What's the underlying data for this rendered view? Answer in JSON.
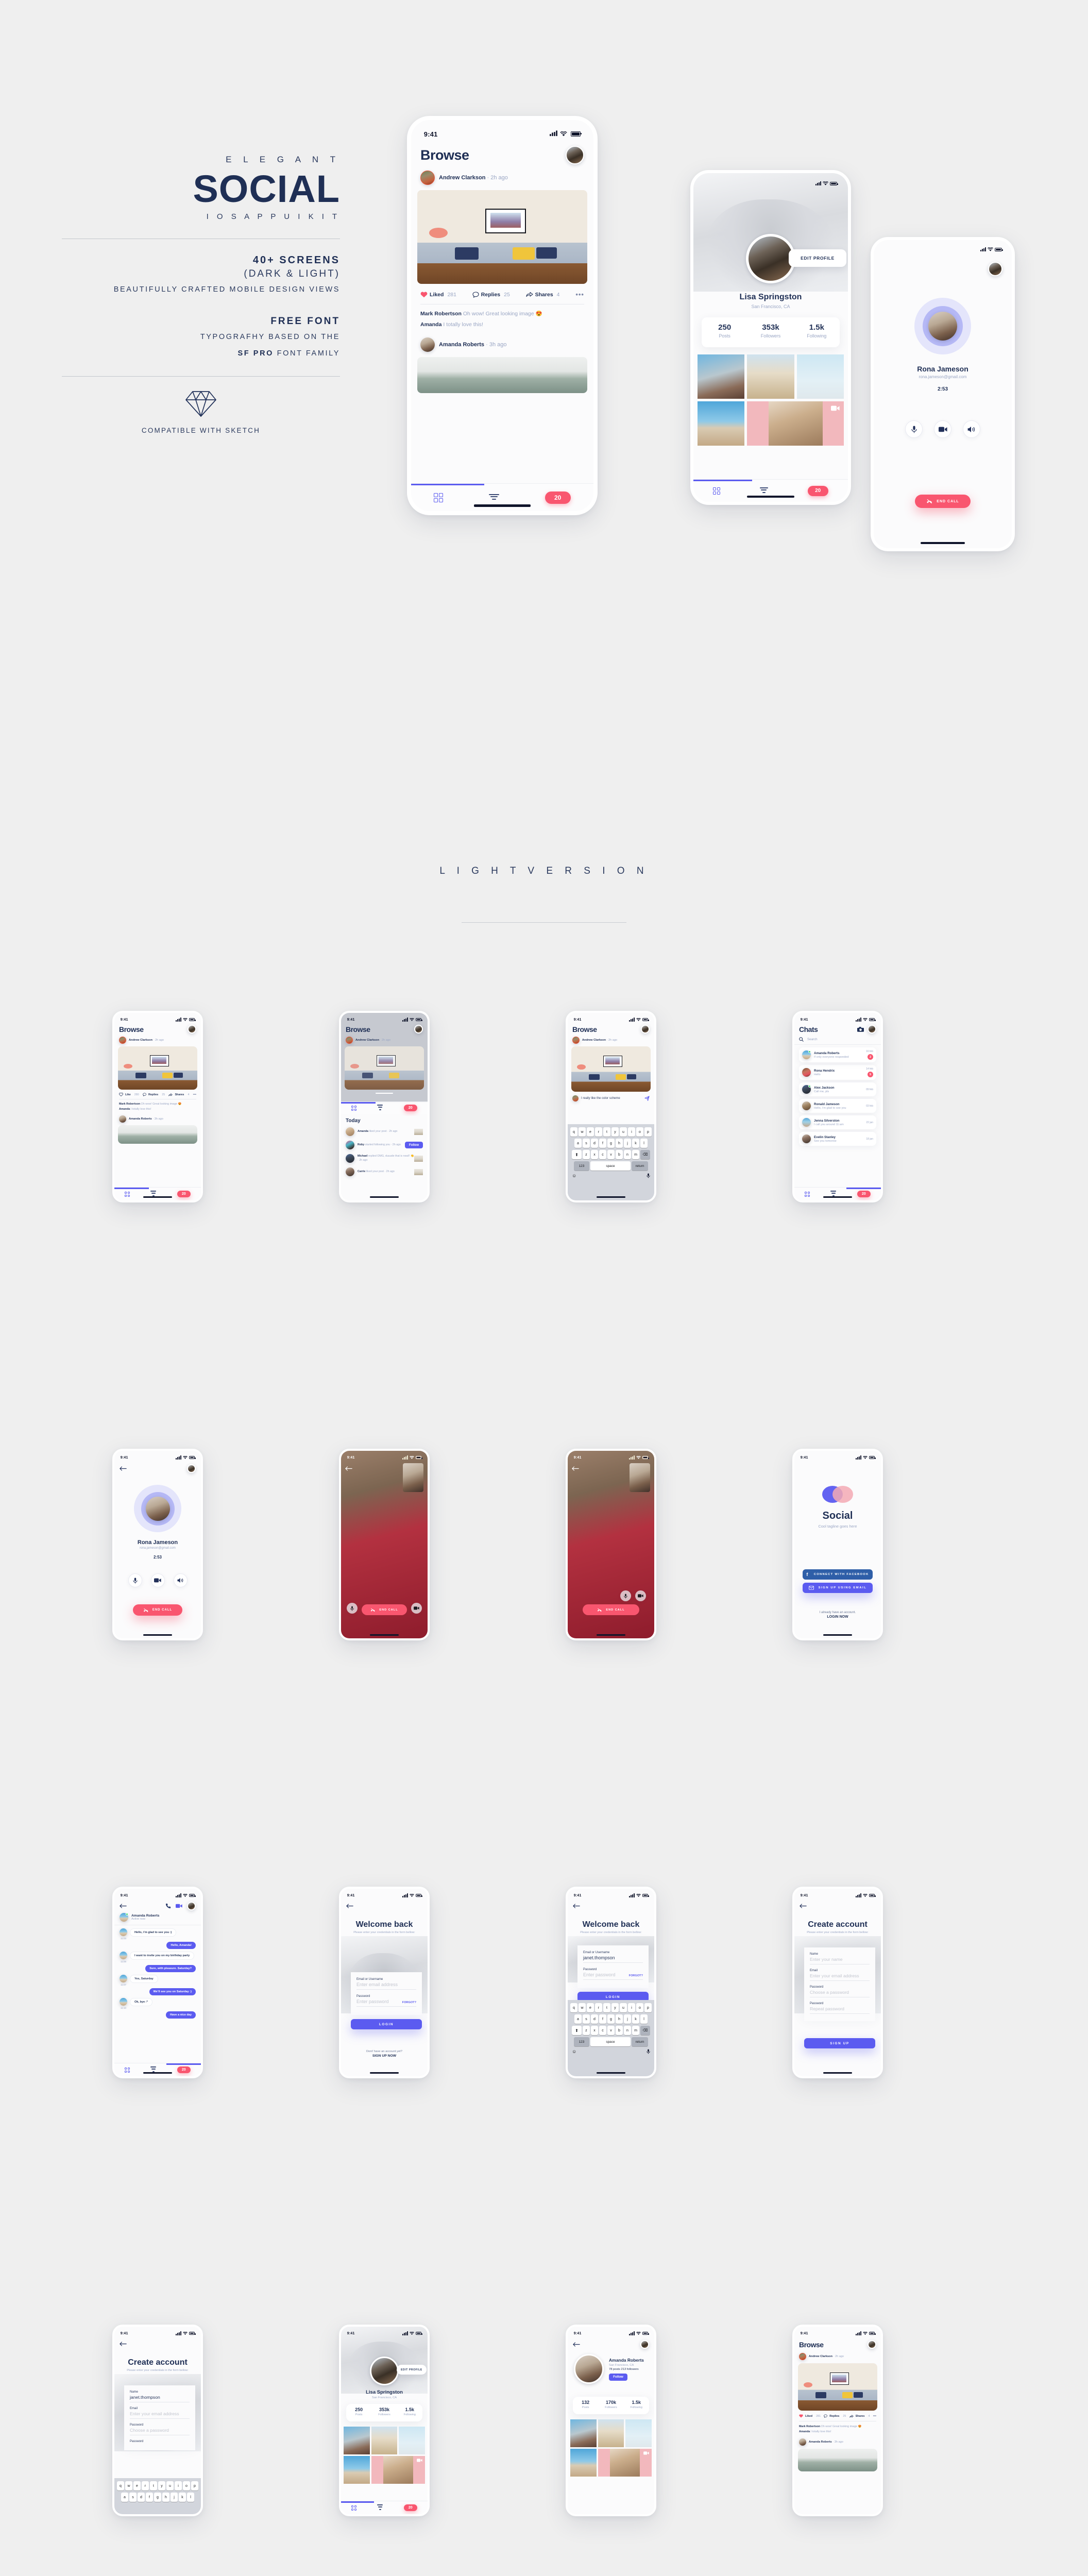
{
  "hero": {
    "eyebrow": "E L E G A N T",
    "title": "SOCIAL",
    "subtitle": "I O S   A P P   U I   K I T",
    "bullet_screens": "40+ SCREENS",
    "bullet_modes": "(DARK & LIGHT)",
    "bullet_desc": "BEAUTIFULLY CRAFTED MOBILE DESIGN VIEWS",
    "free_font": "FREE FONT",
    "font_desc_1": "TYPOGRAFHY BASED ON THE",
    "font_desc_2_bold": "SF PRO",
    "font_desc_2_rest": "FONT FAMILY",
    "sketch_caption": "COMPATIBLE  WITH SKETCH",
    "diamond_icon": "sketch-diamond-icon"
  },
  "section_light": {
    "label": "L I G H T   V E R S I O N"
  },
  "colors": {
    "navy": "#1f2f55",
    "muted": "#9aa6c4",
    "accent_blue": "#5b5bf0",
    "accent_pink": "#f9566f",
    "facebook_blue": "#2f5fa8",
    "background": "#efefef"
  },
  "status_bar": {
    "time": "9:41",
    "signal_icon": "cellular-bars-icon",
    "wifi_icon": "wifi-icon",
    "battery_icon": "battery-full-icon"
  },
  "browse": {
    "title": "Browse",
    "post": {
      "author": "Andrew Clarkson",
      "time": "2h ago",
      "image_alt": "living room sofa photo"
    },
    "actions_liked": {
      "label": "Liked",
      "count": "281",
      "icon": "heart-filled-icon"
    },
    "actions_like": {
      "label": "Like",
      "count": "280",
      "icon": "heart-outline-icon"
    },
    "actions_replies": {
      "label": "Replies",
      "count": "25",
      "icon": "comment-bubble-icon"
    },
    "actions_shares": {
      "label": "Shares",
      "count": "4",
      "icon": "share-arrow-icon"
    },
    "more_icon": "more-dots-icon",
    "comment_1_name": "Mark Robertson",
    "comment_1_text": "Oh wow! Great looking image 😍",
    "comment_2_name": "Amanda",
    "comment_2_text": "I totally love this!",
    "post2_author": "Amanda Roberts",
    "post2_time": "3h ago"
  },
  "tabbar": {
    "grid_icon": "grid-view-icon",
    "filter_icon": "filter-icon",
    "count": "20"
  },
  "profile_lisa": {
    "name": "Lisa Springston",
    "location": "San Francisco, CA",
    "edit_button": "EDIT PROFILE",
    "stats": [
      {
        "value": "250",
        "label": "Posts"
      },
      {
        "value": "353k",
        "label": "Followers"
      },
      {
        "value": "1.5k",
        "label": "Following"
      }
    ],
    "video_icon": "video-camera-icon"
  },
  "profile_amanda": {
    "name": "Amanda Roberts",
    "location": "San Francisco, CA",
    "summary": "78 posts     213 followers",
    "follow_button": "Follow",
    "stats": [
      {
        "value": "132",
        "label": "Posts"
      },
      {
        "value": "170k",
        "label": "Followers"
      },
      {
        "value": "1.5k",
        "label": "Following"
      }
    ],
    "back_icon": "back-arrow-icon",
    "video_icon": "video-camera-icon"
  },
  "call": {
    "name": "Rona Jameson",
    "email": "rona.jameson@gmail.com",
    "duration": "2:53",
    "mic_icon": "microphone-icon",
    "video_icon": "video-camera-icon",
    "speaker_icon": "speaker-icon",
    "end_label": "END CALL",
    "end_icon": "phone-hangup-icon",
    "back_icon": "back-arrow-icon"
  },
  "chats": {
    "title": "Chats",
    "camera_icon": "camera-icon",
    "search_icon": "search-icon",
    "search_placeholder": "Search",
    "rows": [
      {
        "name": "Amanda Roberts",
        "msg": "If only everyone responded",
        "date": "16 feb",
        "badge": "2",
        "online": true
      },
      {
        "name": "Rona Hendrix",
        "msg": "Hello",
        "date": "14 feb",
        "badge": "5",
        "online": false
      },
      {
        "name": "Alex Jackson",
        "msg": "Call me, pls",
        "date": "09 feb",
        "badge": "",
        "online": true
      },
      {
        "name": "Ronald Jameson",
        "msg": "Hello, i’m glad to see you",
        "date": "03 feb",
        "badge": "",
        "online": false
      },
      {
        "name": "Jenna Silverston",
        "msg": "I call you around 11:am",
        "date": "22 jan",
        "badge": "",
        "online": false
      },
      {
        "name": "Evelin Stanley",
        "msg": "See you tomorow",
        "date": "18 jan",
        "badge": "",
        "online": false
      }
    ]
  },
  "conversation": {
    "name": "Amanda Roberts",
    "status": "Active now",
    "phone_icon": "phone-icon",
    "video_icon": "video-camera-icon",
    "back_icon": "back-arrow-icon",
    "messages": [
      {
        "side": "in",
        "text": "Hello, i’m glad to see you :)",
        "time": "11:03"
      },
      {
        "side": "out",
        "text": "Hello, Amanda!",
        "time": ""
      },
      {
        "side": "in",
        "text": "I want to invite you on my birthday party",
        "time": "11:06"
      },
      {
        "side": "out",
        "text": "Sure, with pleasure. Saturday?",
        "time": ""
      },
      {
        "side": "in",
        "text": "Yes, Saturday",
        "time": "11:07"
      },
      {
        "side": "out",
        "text": "We’ll see you on Saturday :)",
        "time": ""
      },
      {
        "side": "in",
        "text": "Ok, bye :*",
        "time": "11:10"
      },
      {
        "side": "out",
        "text": "Have a nice day",
        "time": ""
      }
    ]
  },
  "notifications": {
    "heading": "Today",
    "items": [
      {
        "name": "Amanda",
        "action": "liked your post",
        "time": "· 2h ago",
        "trailing": "thumb"
      },
      {
        "name": "Roby",
        "action": "started following you",
        "time": "· 2h ago",
        "trailing": "follow",
        "follow_label": "Follow"
      },
      {
        "name": "Michael",
        "action": "replied OMG, duuude that is neat!! 👏",
        "time": "· 2h ago",
        "trailing": "thumb"
      },
      {
        "name": "Carrie",
        "action": "liked your post ·",
        "time": "2h ago",
        "trailing": "thumb"
      }
    ]
  },
  "comment_compose": {
    "value": "I really like the color scheme",
    "send_icon": "send-icon",
    "emoji_icon": "emoji-icon",
    "mic_icon": "microphone-icon",
    "keyboard": {
      "row1": [
        "q",
        "w",
        "e",
        "r",
        "t",
        "y",
        "u",
        "i",
        "o",
        "p"
      ],
      "row2": [
        "a",
        "s",
        "d",
        "f",
        "g",
        "h",
        "j",
        "k",
        "l"
      ],
      "row3": [
        "z",
        "x",
        "c",
        "v",
        "b",
        "n",
        "m"
      ],
      "shift_icon": "shift-icon",
      "backspace_icon": "backspace-icon",
      "numbers_key": "123",
      "space_key": "space",
      "return_key": "return"
    }
  },
  "welcome": {
    "title": "Welcome back",
    "subtitle": "Please enter your credentials in the form bellow:",
    "email_label": "Email or Username",
    "email_placeholder": "Enter email address",
    "email_filled": "janet.thompson",
    "password_label": "Password",
    "password_placeholder": "Enter password",
    "forgot": "FORGOT?",
    "login_button": "LOGIN",
    "footer_q": "Dont’ have an account yet?",
    "footer_a": "SIGN UP NOW",
    "back_icon": "back-arrow-icon"
  },
  "signup": {
    "title": "Create account",
    "subtitle": "Please enter your credentials in the form bellow:",
    "name_label": "Name",
    "name_placeholder": "Enter your name",
    "name_filled": "janet.thompson",
    "email_label": "Email",
    "email_placeholder": "Enter your email address",
    "password_label": "Password",
    "password_placeholder": "Choose a password",
    "password2_label": "Password",
    "password2_placeholder": "Repeat password",
    "signup_button": "SIGN UP",
    "back_icon": "back-arrow-icon"
  },
  "splash": {
    "brand": "Social",
    "tagline": "Cool tagline goes here",
    "facebook_button": "CONNECT WITH FACEBOOK",
    "facebook_icon": "facebook-icon",
    "email_button": "SIGN UP USING EMAIL",
    "email_icon": "envelope-icon",
    "footer_q": "I already have an account.",
    "footer_a": "LOGIN NOW",
    "logo_icon": "overlapping-circles-logo"
  },
  "videocall": {
    "end_label": "END CALL",
    "end_icon": "phone-hangup-icon",
    "mic_icon": "microphone-icon",
    "video_icon": "video-camera-icon"
  }
}
